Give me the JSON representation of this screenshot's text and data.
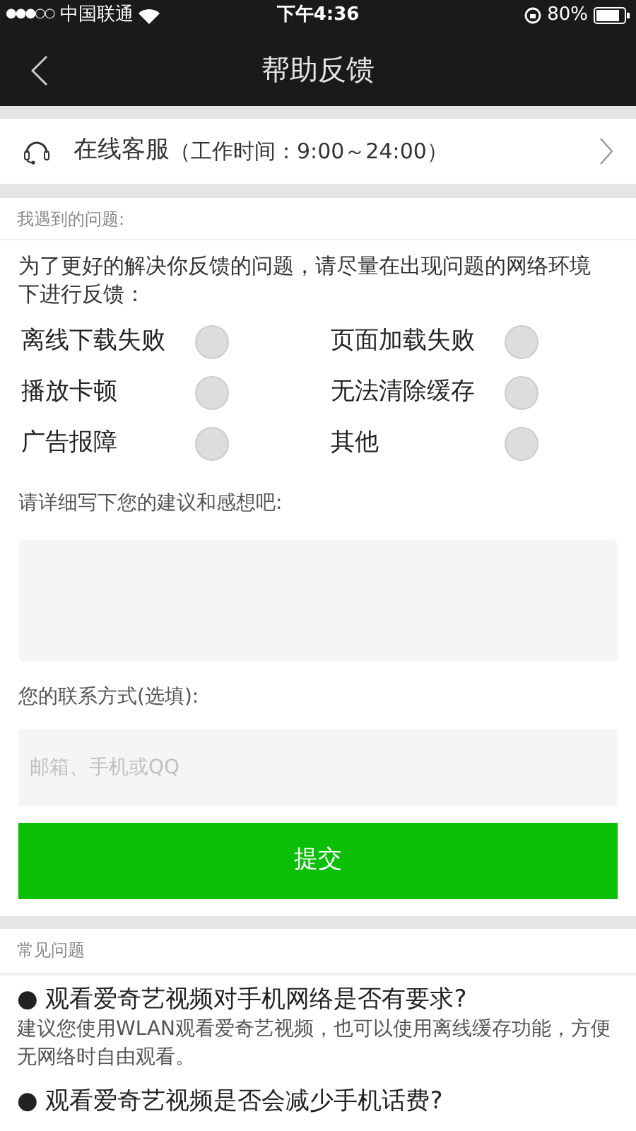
{
  "status_bar": {
    "signal_dots": "●●●○○",
    "carrier": "中国联通",
    "time": "下午4:36",
    "battery": "80%"
  },
  "nav": {
    "title": "帮助反馈"
  },
  "service": {
    "label": "在线客服",
    "hours": "（工作时间：9:00～24:00）"
  },
  "problems": {
    "heading": "我遇到的问题:",
    "intro": "为了更好的解决你反馈的问题，请尽量在出现问题的网络环境下进行反馈：",
    "options": [
      {
        "label": "离线下载失败",
        "checked": false
      },
      {
        "label": "页面加载失败",
        "checked": false
      },
      {
        "label": "播放卡顿",
        "checked": false
      },
      {
        "label": "无法清除缓存",
        "checked": false
      },
      {
        "label": "广告报障",
        "checked": false
      },
      {
        "label": "其他",
        "checked": false
      }
    ],
    "comment_label": "请详细写下您的建议和感想吧:",
    "contact_label": "您的联系方式(选填):",
    "contact_placeholder": "邮箱、手机或QQ",
    "submit": "提交"
  },
  "faq": {
    "heading": "常见问题",
    "items": [
      {
        "question": "● 观看爱奇艺视频对手机网络是否有要求?",
        "answer": "建议您使用WLAN观看爱奇艺视频，也可以使用离线缓存功能，方便无网络时自由观看。"
      },
      {
        "question": "● 观看爱奇艺视频是否会减少手机话费?"
      }
    ]
  }
}
